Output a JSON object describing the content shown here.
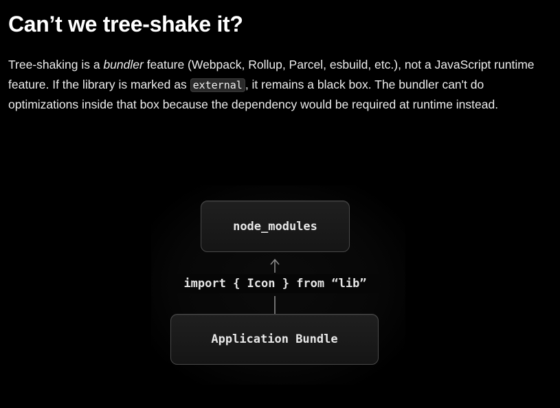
{
  "heading": "Can’t we tree-shake it?",
  "paragraph": {
    "part1": "Tree-shaking is a ",
    "emphasis": "bundler",
    "part2": " feature (Webpack, Rollup, Parcel, esbuild, etc.), not a JavaScript runtime feature. If the library is marked as ",
    "code": "external",
    "part3": ", it remains a black box. The bundler can't do optimizations inside that box because the dependency would be required at runtime instead."
  },
  "diagram": {
    "top_box_label": "node_modules",
    "connector_label": "import { Icon } from “lib”",
    "bottom_box_label": "Application Bundle",
    "arrow_icon": "arrow-up-icon",
    "colors": {
      "background": "#000000",
      "box_border": "#4a4a4a",
      "box_fill": "#1a1a1a",
      "text": "#e8e8e8",
      "line": "#8a8a8a"
    }
  }
}
